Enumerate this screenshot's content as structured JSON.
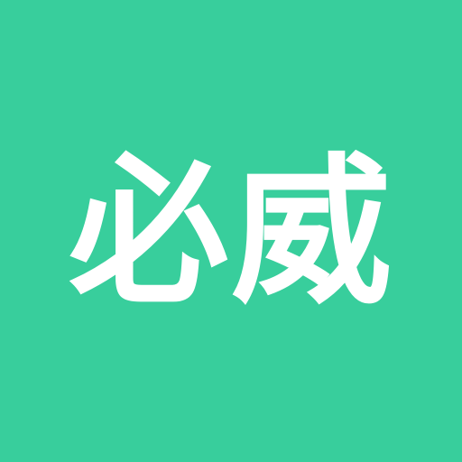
{
  "logo": {
    "text": "必威"
  },
  "colors": {
    "background": "#38CE9C",
    "text": "#FFFFFF"
  }
}
